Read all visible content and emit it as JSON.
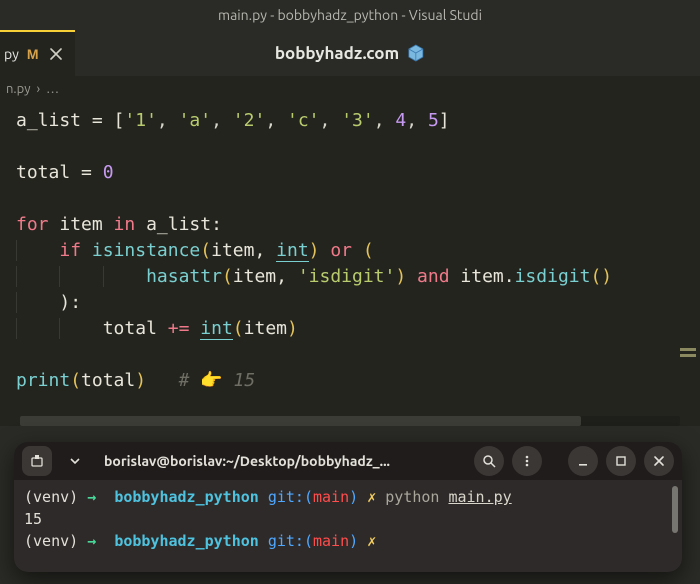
{
  "window_title": "main.py - bobbyhadz_python - Visual Studi",
  "tab": {
    "label": "py",
    "modified_marker": "M"
  },
  "center_link": "bobbyhadz.com",
  "breadcrumb": {
    "file": "n.py",
    "sep": "›",
    "more": "…"
  },
  "code": {
    "l1": {
      "a": "a_list",
      "b": " = [",
      "s1": "'1'",
      "c1": ", ",
      "s2": "'a'",
      "c2": ", ",
      "s3": "'2'",
      "c3": ", ",
      "s4": "'c'",
      "c4": ", ",
      "s5": "'3'",
      "c5": ", ",
      "n1": "4",
      "c6": ", ",
      "n2": "5",
      "d": "]"
    },
    "l2": {
      "a": "total",
      "b": " = ",
      "n": "0"
    },
    "l3": {
      "k1": "for",
      "a": " item ",
      "k2": "in",
      "b": " a_list:"
    },
    "l4": {
      "k": "if",
      "sp": " ",
      "fn": "isinstance",
      "o1": "(",
      "a1": "item, ",
      "bi": "int",
      "o2": ")",
      "sp2": " ",
      "or": "or",
      "sp3": " ",
      "o3": "("
    },
    "l5": {
      "fn": "hasattr",
      "o1": "(",
      "a1": "item, ",
      "s": "'isdigit'",
      "o2": ")",
      "sp": " ",
      "and": "and",
      "sp2": " ",
      "a2": "item.",
      "m": "isdigit",
      "o3": "()"
    },
    "l6": {
      "a": "):"
    },
    "l7": {
      "a": "total ",
      "op": "+=",
      "sp": " ",
      "fn": "int",
      "o1": "(",
      "arg": "item",
      "o2": ")"
    },
    "l8": {
      "fn": "print",
      "o1": "(",
      "a": "total",
      "o2": ")",
      "sp": "   ",
      "cmt": "#    15"
    }
  },
  "terminal": {
    "title": "borislav@borislav:~/Desktop/bobbyhadz_...",
    "lines": {
      "r1": {
        "venv": "(venv)",
        "arrow": "→",
        "dir": "bobbyhadz_python",
        "git": "git:(",
        "br": "main",
        "git2": ")",
        "x": "✗",
        "cmd": "python",
        "file": "main.py"
      },
      "r2": {
        "out": "15"
      },
      "r3": {
        "venv": "(venv)",
        "arrow": "→",
        "dir": "bobbyhadz_python",
        "git": "git:(",
        "br": "main",
        "git2": ")",
        "x": "✗"
      }
    }
  }
}
